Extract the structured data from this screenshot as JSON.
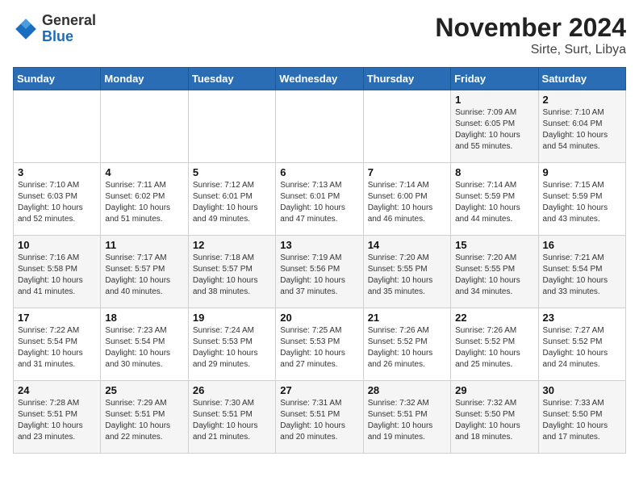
{
  "header": {
    "logo_general": "General",
    "logo_blue": "Blue",
    "month_title": "November 2024",
    "location": "Sirte, Surt, Libya"
  },
  "days_of_week": [
    "Sunday",
    "Monday",
    "Tuesday",
    "Wednesday",
    "Thursday",
    "Friday",
    "Saturday"
  ],
  "weeks": [
    [
      {
        "day": "",
        "info": ""
      },
      {
        "day": "",
        "info": ""
      },
      {
        "day": "",
        "info": ""
      },
      {
        "day": "",
        "info": ""
      },
      {
        "day": "",
        "info": ""
      },
      {
        "day": "1",
        "info": "Sunrise: 7:09 AM\nSunset: 6:05 PM\nDaylight: 10 hours and 55 minutes."
      },
      {
        "day": "2",
        "info": "Sunrise: 7:10 AM\nSunset: 6:04 PM\nDaylight: 10 hours and 54 minutes."
      }
    ],
    [
      {
        "day": "3",
        "info": "Sunrise: 7:10 AM\nSunset: 6:03 PM\nDaylight: 10 hours and 52 minutes."
      },
      {
        "day": "4",
        "info": "Sunrise: 7:11 AM\nSunset: 6:02 PM\nDaylight: 10 hours and 51 minutes."
      },
      {
        "day": "5",
        "info": "Sunrise: 7:12 AM\nSunset: 6:01 PM\nDaylight: 10 hours and 49 minutes."
      },
      {
        "day": "6",
        "info": "Sunrise: 7:13 AM\nSunset: 6:01 PM\nDaylight: 10 hours and 47 minutes."
      },
      {
        "day": "7",
        "info": "Sunrise: 7:14 AM\nSunset: 6:00 PM\nDaylight: 10 hours and 46 minutes."
      },
      {
        "day": "8",
        "info": "Sunrise: 7:14 AM\nSunset: 5:59 PM\nDaylight: 10 hours and 44 minutes."
      },
      {
        "day": "9",
        "info": "Sunrise: 7:15 AM\nSunset: 5:59 PM\nDaylight: 10 hours and 43 minutes."
      }
    ],
    [
      {
        "day": "10",
        "info": "Sunrise: 7:16 AM\nSunset: 5:58 PM\nDaylight: 10 hours and 41 minutes."
      },
      {
        "day": "11",
        "info": "Sunrise: 7:17 AM\nSunset: 5:57 PM\nDaylight: 10 hours and 40 minutes."
      },
      {
        "day": "12",
        "info": "Sunrise: 7:18 AM\nSunset: 5:57 PM\nDaylight: 10 hours and 38 minutes."
      },
      {
        "day": "13",
        "info": "Sunrise: 7:19 AM\nSunset: 5:56 PM\nDaylight: 10 hours and 37 minutes."
      },
      {
        "day": "14",
        "info": "Sunrise: 7:20 AM\nSunset: 5:55 PM\nDaylight: 10 hours and 35 minutes."
      },
      {
        "day": "15",
        "info": "Sunrise: 7:20 AM\nSunset: 5:55 PM\nDaylight: 10 hours and 34 minutes."
      },
      {
        "day": "16",
        "info": "Sunrise: 7:21 AM\nSunset: 5:54 PM\nDaylight: 10 hours and 33 minutes."
      }
    ],
    [
      {
        "day": "17",
        "info": "Sunrise: 7:22 AM\nSunset: 5:54 PM\nDaylight: 10 hours and 31 minutes."
      },
      {
        "day": "18",
        "info": "Sunrise: 7:23 AM\nSunset: 5:54 PM\nDaylight: 10 hours and 30 minutes."
      },
      {
        "day": "19",
        "info": "Sunrise: 7:24 AM\nSunset: 5:53 PM\nDaylight: 10 hours and 29 minutes."
      },
      {
        "day": "20",
        "info": "Sunrise: 7:25 AM\nSunset: 5:53 PM\nDaylight: 10 hours and 27 minutes."
      },
      {
        "day": "21",
        "info": "Sunrise: 7:26 AM\nSunset: 5:52 PM\nDaylight: 10 hours and 26 minutes."
      },
      {
        "day": "22",
        "info": "Sunrise: 7:26 AM\nSunset: 5:52 PM\nDaylight: 10 hours and 25 minutes."
      },
      {
        "day": "23",
        "info": "Sunrise: 7:27 AM\nSunset: 5:52 PM\nDaylight: 10 hours and 24 minutes."
      }
    ],
    [
      {
        "day": "24",
        "info": "Sunrise: 7:28 AM\nSunset: 5:51 PM\nDaylight: 10 hours and 23 minutes."
      },
      {
        "day": "25",
        "info": "Sunrise: 7:29 AM\nSunset: 5:51 PM\nDaylight: 10 hours and 22 minutes."
      },
      {
        "day": "26",
        "info": "Sunrise: 7:30 AM\nSunset: 5:51 PM\nDaylight: 10 hours and 21 minutes."
      },
      {
        "day": "27",
        "info": "Sunrise: 7:31 AM\nSunset: 5:51 PM\nDaylight: 10 hours and 20 minutes."
      },
      {
        "day": "28",
        "info": "Sunrise: 7:32 AM\nSunset: 5:51 PM\nDaylight: 10 hours and 19 minutes."
      },
      {
        "day": "29",
        "info": "Sunrise: 7:32 AM\nSunset: 5:50 PM\nDaylight: 10 hours and 18 minutes."
      },
      {
        "day": "30",
        "info": "Sunrise: 7:33 AM\nSunset: 5:50 PM\nDaylight: 10 hours and 17 minutes."
      }
    ]
  ]
}
